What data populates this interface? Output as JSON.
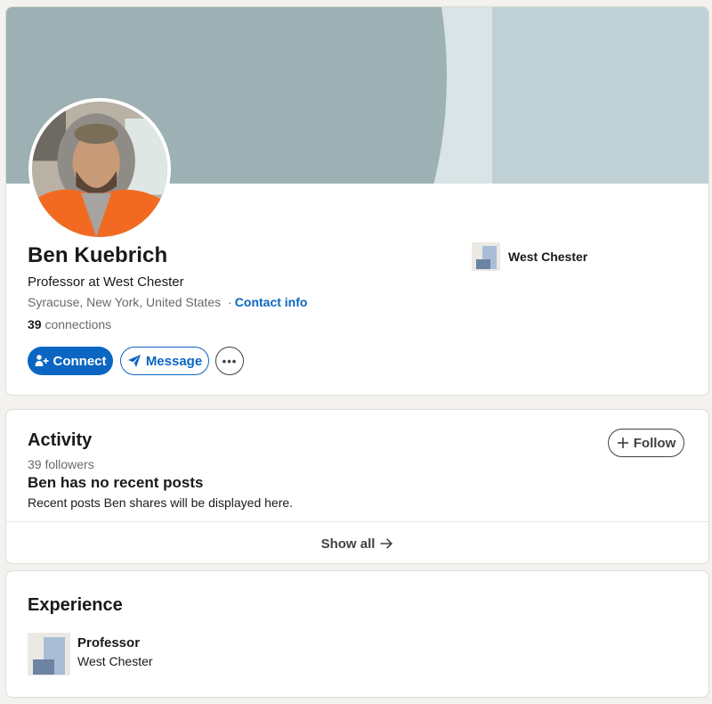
{
  "profile": {
    "name": "Ben Kuebrich",
    "headline": "Professor at West Chester",
    "location": "Syracuse, New York, United States",
    "contact_separator": "·",
    "contact_link": "Contact info",
    "connections_count": "39",
    "connections_label": "connections",
    "current_company": "West Chester",
    "actions": {
      "connect": "Connect",
      "message": "Message",
      "more": "•••"
    }
  },
  "activity": {
    "title": "Activity",
    "followers": "39 followers",
    "follow_button": "Follow",
    "empty_heading": "Ben has no recent posts",
    "empty_description": "Recent posts Ben shares will be displayed here.",
    "show_all": "Show all"
  },
  "experience": {
    "title": "Experience",
    "items": [
      {
        "role": "Professor",
        "company": "West Chester"
      }
    ]
  },
  "icons": {
    "connect": "add-person-icon",
    "message": "send-arrow-icon",
    "more": "more-horizontal-icon",
    "follow": "plus-icon",
    "show_all": "arrow-right-icon"
  },
  "colors": {
    "accent": "#0a66c2",
    "banner_light": "#bfd1d4",
    "banner_dark": "#9db1b4"
  }
}
